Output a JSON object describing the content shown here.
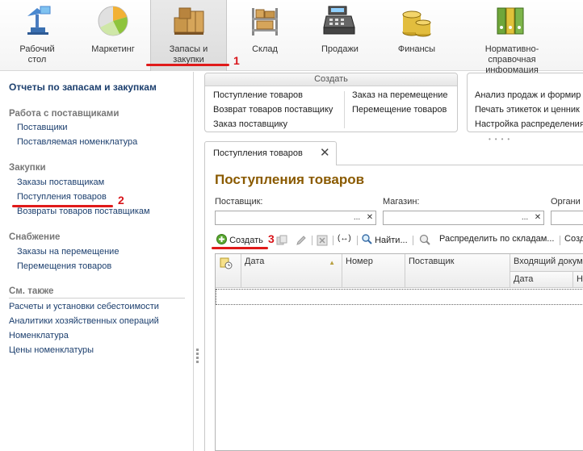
{
  "sections": [
    {
      "label": "Рабочий стол",
      "icon": "desktop-icon"
    },
    {
      "label": "Маркетинг",
      "icon": "pie-chart-icon"
    },
    {
      "label": "Запасы и закупки",
      "icon": "boxes-icon"
    },
    {
      "label": "Склад",
      "icon": "warehouse-shelf-icon"
    },
    {
      "label": "Продажи",
      "icon": "cash-register-icon"
    },
    {
      "label": "Финансы",
      "icon": "coins-icon"
    },
    {
      "label": "Нормативно-справочная информация",
      "icon": "binders-icon"
    }
  ],
  "markers": {
    "m1": "1",
    "m2": "2",
    "m3": "3"
  },
  "left_panel": {
    "title": "Отчеты по запасам и закупкам",
    "group1": "Работа с поставщиками",
    "group1_items": [
      "Поставщики",
      "Поставляемая номенклатура"
    ],
    "group2": "Закупки",
    "group2_items": [
      "Заказы поставщикам",
      "Поступления товаров",
      "Возвраты товаров поставщикам"
    ],
    "group3": "Снабжение",
    "group3_items": [
      "Заказы на перемещение",
      "Перемещения товаров"
    ],
    "group4": "См. также",
    "group4_items": [
      "Расчеты и установки себестоимости",
      "Аналитики хозяйственных операций",
      "Номенклатура",
      "Цены номенклатуры"
    ]
  },
  "create_panel": {
    "title": "Создать",
    "col1": [
      "Поступление товаров",
      "Возврат товаров поставщику",
      "Заказ поставщику"
    ],
    "col2": [
      "Заказ на перемещение",
      "Перемещение товаров"
    ]
  },
  "reports_panel": {
    "items": [
      "Анализ продаж и формир",
      "Печать этикеток и ценник",
      "Настройка распределения"
    ]
  },
  "tab": {
    "label": "Поступления товаров",
    "close": "✕"
  },
  "form": {
    "title": "Поступления товаров",
    "supplier_label": "Поставщик:",
    "store_label": "Магазин:",
    "org_label": "Органи",
    "dots": "...",
    "clear": "✕"
  },
  "toolbar": {
    "create": "Создать",
    "find": "Найти...",
    "distribute": "Распределить по складам...",
    "create2": "Созд"
  },
  "grid": {
    "columns": [
      "Дата",
      "Номер",
      "Поставщик",
      "Входящий докуме"
    ],
    "sub_columns": [
      "Дата",
      "Н"
    ]
  },
  "colors": {
    "accent_title": "#8a5a00",
    "link": "#1c3f6e",
    "marker": "#d8141a"
  }
}
